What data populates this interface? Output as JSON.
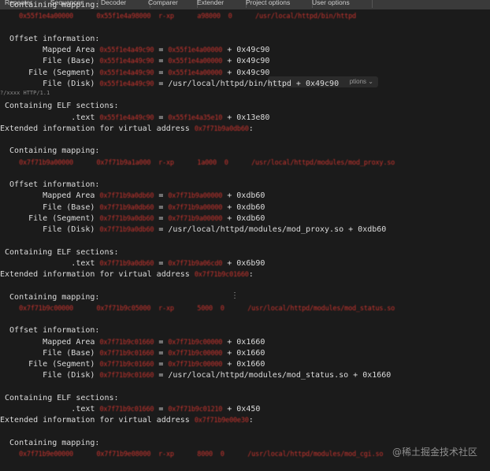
{
  "tabs": [
    "Repeater",
    "Sequencer",
    "Decoder",
    "Comparer",
    "Extender",
    "Project options",
    "User options"
  ],
  "overlay": {
    "options_label": "ptions",
    "request_fragment": "?/xxxx HTTP/1.1"
  },
  "watermark": "@稀土掘金技术社区",
  "lines": [
    [
      {
        "t": "  Containing mapping:"
      }
    ],
    [
      {
        "t": "    "
      },
      {
        "t": "0x55f1e4a00000      0x55f1e4a98000  r-xp      a98000  0      /usr/local/httpd/bin/httpd",
        "r": true
      }
    ],
    [
      {
        "t": ""
      }
    ],
    [
      {
        "t": "  Offset information:"
      }
    ],
    [
      {
        "t": "         Mapped Area "
      },
      {
        "t": "0x55f1e4a49c90",
        "r": true
      },
      {
        "t": " = "
      },
      {
        "t": "0x55f1e4a00000",
        "r": true
      },
      {
        "t": " + 0x49c90"
      }
    ],
    [
      {
        "t": "         File (Base) "
      },
      {
        "t": "0x55f1e4a49c90",
        "r": true
      },
      {
        "t": " = "
      },
      {
        "t": "0x55f1e4a00000",
        "r": true
      },
      {
        "t": " + 0x49c90"
      }
    ],
    [
      {
        "t": "      File (Segment) "
      },
      {
        "t": "0x55f1e4a49c90",
        "r": true
      },
      {
        "t": " = "
      },
      {
        "t": "0x55f1e4a00000",
        "r": true
      },
      {
        "t": " + 0x49c90"
      }
    ],
    [
      {
        "t": "         File (Disk) "
      },
      {
        "t": "0x55f1e4a49c90",
        "r": true
      },
      {
        "t": " = /usr/local/httpd/bin/httpd + 0x49c90"
      }
    ],
    [
      {
        "t": ""
      }
    ],
    [
      {
        "t": " Containing ELF sections:"
      }
    ],
    [
      {
        "t": "               .text "
      },
      {
        "t": "0x55f1e4a49c90",
        "r": true
      },
      {
        "t": " = "
      },
      {
        "t": "0x55f1e4a35e10",
        "r": true
      },
      {
        "t": " + 0x13e80"
      }
    ],
    [
      {
        "t": "Extended information for virtual address "
      },
      {
        "t": "0x7f71b9a0db60",
        "r": true
      },
      {
        "t": ":"
      }
    ],
    [
      {
        "t": ""
      }
    ],
    [
      {
        "t": "  Containing mapping:"
      }
    ],
    [
      {
        "t": "    "
      },
      {
        "t": "0x7f71b9a00000      0x7f71b9a1a000  r-xp      1a000  0      /usr/local/httpd/modules/mod_proxy.so",
        "r": true
      }
    ],
    [
      {
        "t": ""
      }
    ],
    [
      {
        "t": "  Offset information:"
      }
    ],
    [
      {
        "t": "         Mapped Area "
      },
      {
        "t": "0x7f71b9a0db60",
        "r": true
      },
      {
        "t": " = "
      },
      {
        "t": "0x7f71b9a00000",
        "r": true
      },
      {
        "t": " + 0xdb60"
      }
    ],
    [
      {
        "t": "         File (Base) "
      },
      {
        "t": "0x7f71b9a0db60",
        "r": true
      },
      {
        "t": " = "
      },
      {
        "t": "0x7f71b9a00000",
        "r": true
      },
      {
        "t": " + 0xdb60"
      }
    ],
    [
      {
        "t": "      File (Segment) "
      },
      {
        "t": "0x7f71b9a0db60",
        "r": true
      },
      {
        "t": " = "
      },
      {
        "t": "0x7f71b9a00000",
        "r": true
      },
      {
        "t": " + 0xdb60"
      }
    ],
    [
      {
        "t": "         File (Disk) "
      },
      {
        "t": "0x7f71b9a0db60",
        "r": true
      },
      {
        "t": " = /usr/local/httpd/modules/mod_proxy.so + 0xdb60"
      }
    ],
    [
      {
        "t": ""
      }
    ],
    [
      {
        "t": " Containing ELF sections:"
      }
    ],
    [
      {
        "t": "               .text "
      },
      {
        "t": "0x7f71b9a0db60",
        "r": true
      },
      {
        "t": " = "
      },
      {
        "t": "0x7f71b9a06cd0",
        "r": true
      },
      {
        "t": " + 0x6b90"
      }
    ],
    [
      {
        "t": "Extended information for virtual address "
      },
      {
        "t": "0x7f71b9c01660",
        "r": true
      },
      {
        "t": ":"
      }
    ],
    [
      {
        "t": ""
      }
    ],
    [
      {
        "t": "  Containing mapping:"
      }
    ],
    [
      {
        "t": "    "
      },
      {
        "t": "0x7f71b9c00000      0x7f71b9c05000  r-xp      5000  0      /usr/local/httpd/modules/mod_status.so",
        "r": true
      }
    ],
    [
      {
        "t": ""
      }
    ],
    [
      {
        "t": "  Offset information:"
      }
    ],
    [
      {
        "t": "         Mapped Area "
      },
      {
        "t": "0x7f71b9c01660",
        "r": true
      },
      {
        "t": " = "
      },
      {
        "t": "0x7f71b9c00000",
        "r": true
      },
      {
        "t": " + 0x1660"
      }
    ],
    [
      {
        "t": "         File (Base) "
      },
      {
        "t": "0x7f71b9c01660",
        "r": true
      },
      {
        "t": " = "
      },
      {
        "t": "0x7f71b9c00000",
        "r": true
      },
      {
        "t": " + 0x1660"
      }
    ],
    [
      {
        "t": "      File (Segment) "
      },
      {
        "t": "0x7f71b9c01660",
        "r": true
      },
      {
        "t": " = "
      },
      {
        "t": "0x7f71b9c00000",
        "r": true
      },
      {
        "t": " + 0x1660"
      }
    ],
    [
      {
        "t": "         File (Disk) "
      },
      {
        "t": "0x7f71b9c01660",
        "r": true
      },
      {
        "t": " = /usr/local/httpd/modules/mod_status.so + 0x1660"
      }
    ],
    [
      {
        "t": ""
      }
    ],
    [
      {
        "t": " Containing ELF sections:"
      }
    ],
    [
      {
        "t": "               .text "
      },
      {
        "t": "0x7f71b9c01660",
        "r": true
      },
      {
        "t": " = "
      },
      {
        "t": "0x7f71b9c01210",
        "r": true
      },
      {
        "t": " + 0x450"
      }
    ],
    [
      {
        "t": "Extended information for virtual address "
      },
      {
        "t": "0x7f71b9e00e30",
        "r": true
      },
      {
        "t": ":"
      }
    ],
    [
      {
        "t": ""
      }
    ],
    [
      {
        "t": "  Containing mapping:"
      }
    ],
    [
      {
        "t": "    "
      },
      {
        "t": "0x7f71b9e00000      0x7f71b9e08000  r-xp      8000  0      /usr/local/httpd/modules/mod_cgi.so",
        "r": true
      }
    ]
  ]
}
